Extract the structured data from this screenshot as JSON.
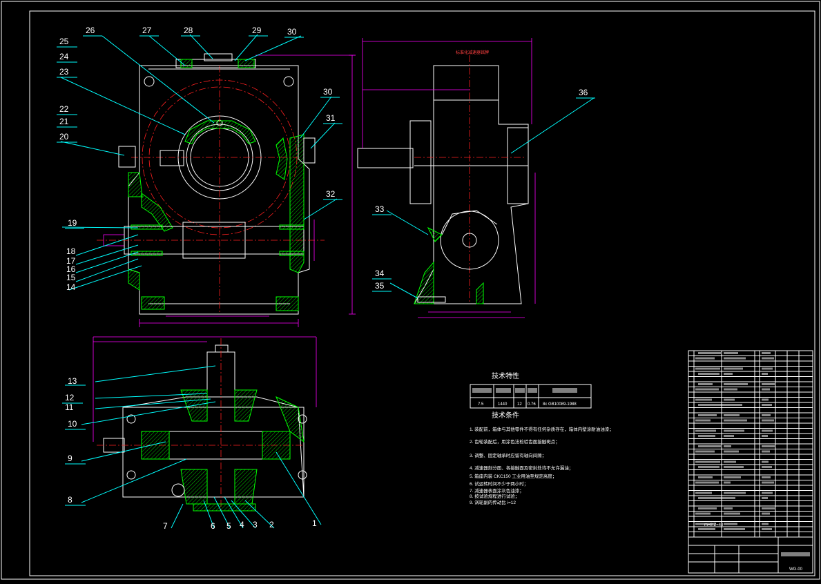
{
  "drawing": {
    "part_numbers": [
      "1",
      "2",
      "3",
      "4",
      "5",
      "6",
      "7",
      "8",
      "9",
      "10",
      "11",
      "12",
      "13",
      "14",
      "15",
      "16",
      "17",
      "18",
      "19",
      "20",
      "21",
      "22",
      "23",
      "24",
      "25",
      "26",
      "27",
      "28",
      "29",
      "30",
      "31",
      "32",
      "33",
      "34",
      "35",
      "36"
    ],
    "tech_characteristics": {
      "title": "技术特性",
      "values": [
        "7.5",
        "1440",
        "12",
        "0.76",
        "8c GB10089-1988"
      ]
    },
    "tech_requirements": {
      "title": "技术条件",
      "items": [
        "1. 装配前，箱体与其他零件不得有任何杂质存在，箱体内壁涂耐油油漆；",
        "2. 齿轮装配后，用涂色法检验齿面接触斑点；",
        "3. 调整、固定轴承时应留有轴向间隙；",
        "4. 减速器剖分面、各接触面及密封处均不允许漏油；",
        "5. 箱座内装 CKC150 工业用油至规定高度；",
        "6. 试运转时间不少于两小时；",
        "7. 减速器表面涂灰色油漆；",
        "8. 按试验规程进行试验；",
        "9. 涡轮副的传动比 i=12"
      ]
    },
    "title_block": {
      "spec_line": "m=8  Z=48",
      "drawing_no": "WG-00"
    }
  }
}
